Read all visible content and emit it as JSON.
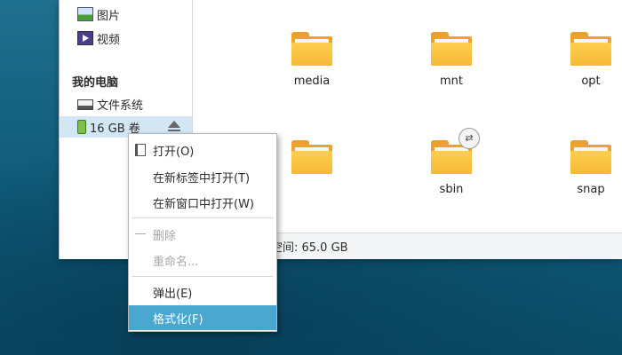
{
  "sidebar": {
    "items_top": [
      {
        "label": "图片",
        "icon": "image-icon"
      },
      {
        "label": "视频",
        "icon": "video-icon"
      }
    ],
    "section_title": "我的电脑",
    "items_device": [
      {
        "label": "文件系统",
        "icon": "drive-icon"
      },
      {
        "label": "16 GB 卷",
        "icon": "usb-drive-icon",
        "selected": true
      }
    ]
  },
  "files": [
    {
      "name": "media",
      "icon": "folder-icon"
    },
    {
      "name": "mnt",
      "icon": "folder-icon"
    },
    {
      "name": "opt",
      "icon": "folder-icon"
    },
    {
      "name": "",
      "icon": "folder-icon"
    },
    {
      "name": "sbin",
      "icon": "folder-icon",
      "badge": "symlink-icon"
    },
    {
      "name": "snap",
      "icon": "folder-icon"
    }
  ],
  "status": {
    "free_space": "空间: 65.0 GB"
  },
  "context_menu": {
    "items": [
      {
        "label": "打开(O)",
        "state": "normal"
      },
      {
        "label": "在新标签中打开(T)",
        "state": "normal"
      },
      {
        "label": "在新窗口中打开(W)",
        "state": "normal"
      },
      {
        "label": "删除",
        "state": "disabled"
      },
      {
        "label": "重命名...",
        "state": "disabled"
      },
      {
        "label": "弹出(E)",
        "state": "normal"
      },
      {
        "label": "格式化(F)",
        "state": "highlighted"
      }
    ]
  },
  "colors": {
    "accent": "#4aa7cf",
    "selection": "#d2e6f4",
    "folder": "#f5b936"
  }
}
